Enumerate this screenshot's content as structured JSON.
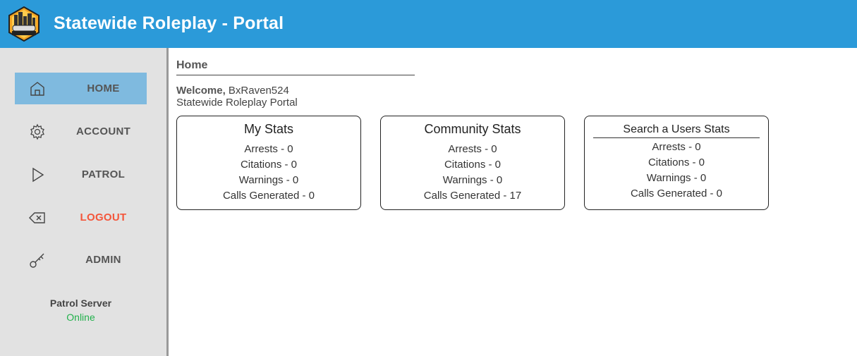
{
  "header": {
    "title": "Statewide Roleplay - Portal",
    "logo_icon": "statewide-logo"
  },
  "sidebar": {
    "items": [
      {
        "label": "HOME",
        "icon": "home-icon"
      },
      {
        "label": "ACCOUNT",
        "icon": "gear-icon"
      },
      {
        "label": "PATROL",
        "icon": "play-icon"
      },
      {
        "label": "LOGOUT",
        "icon": "backspace-icon"
      },
      {
        "label": "ADMIN",
        "icon": "key-icon"
      }
    ],
    "server": {
      "label": "Patrol Server",
      "status": "Online"
    }
  },
  "colors": {
    "header": "#2b9ad9",
    "active_nav": "#7fbadf",
    "logout": "#f4553a",
    "online": "#22b14c"
  },
  "main": {
    "title": "Home",
    "welcome_label": "Welcome,",
    "username": "BxRaven524",
    "subtitle": "Statewide Roleplay Portal",
    "cards": [
      {
        "title": "My Stats",
        "lines": [
          "Arrests - 0",
          "Citations - 0",
          "Warnings - 0",
          "Calls Generated - 0"
        ]
      },
      {
        "title": "Community Stats",
        "lines": [
          "Arrests - 0",
          "Citations - 0",
          "Warnings - 0",
          "Calls Generated - 17"
        ]
      },
      {
        "title": "Search a Users Stats",
        "lines": [
          "Arrests - 0",
          "Citations - 0",
          "Warnings - 0",
          "Calls Generated - 0"
        ]
      }
    ]
  }
}
